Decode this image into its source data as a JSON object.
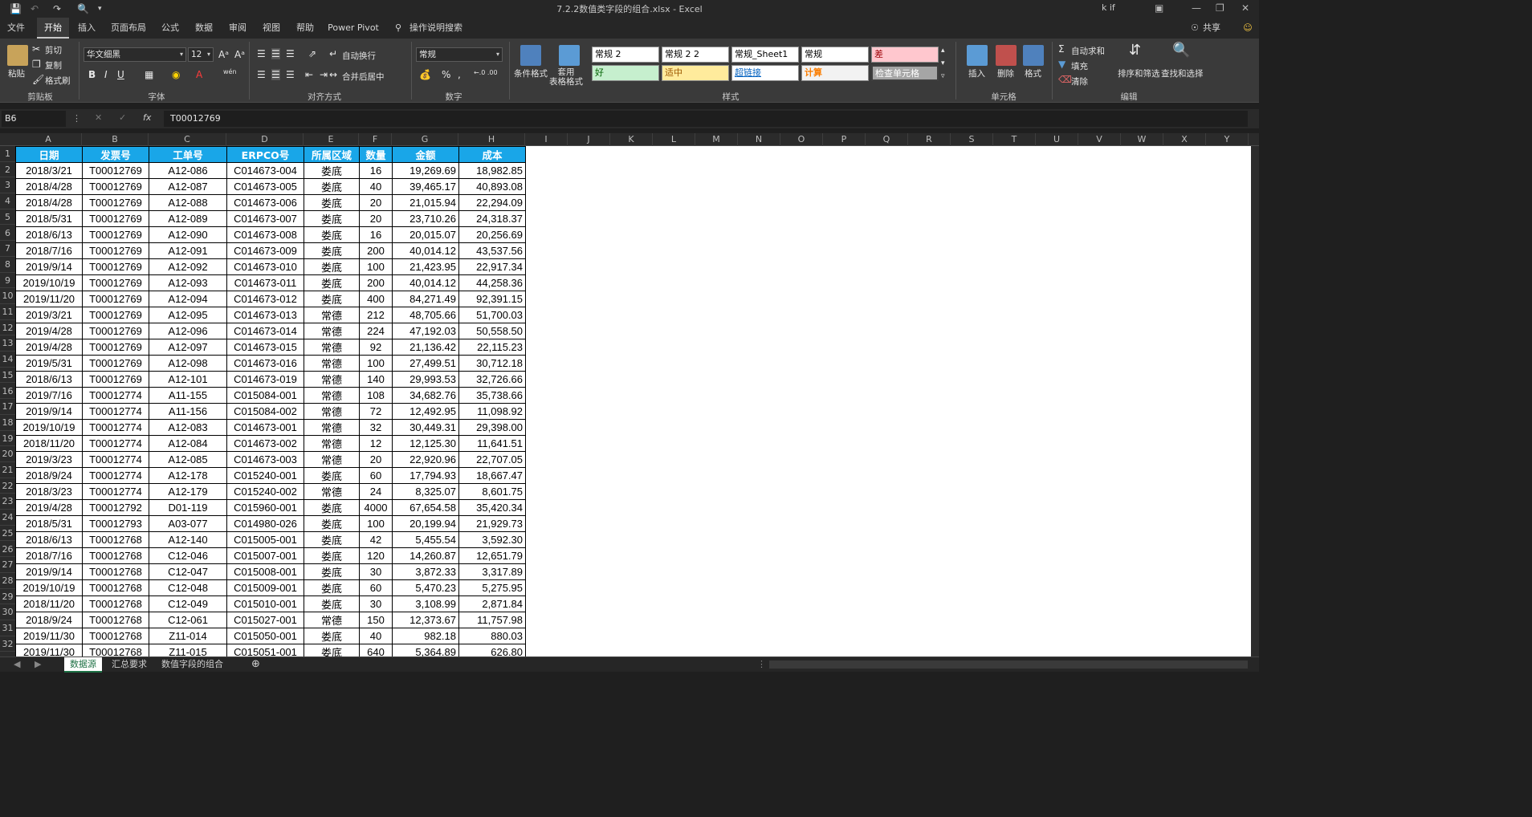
{
  "window": {
    "title": "7.2.2数值类字段的组合.xlsx  -  Excel",
    "user": "k if",
    "share_label": "共享"
  },
  "ribbon_tabs": [
    "文件",
    "开始",
    "插入",
    "页面布局",
    "公式",
    "数据",
    "审阅",
    "视图",
    "帮助",
    "Power Pivot",
    "操作说明搜索"
  ],
  "clipboard": {
    "paste": "粘贴",
    "cut": "剪切",
    "copy": "复制",
    "format_painter": "格式刷",
    "label": "剪贴板"
  },
  "font": {
    "name": "华文细黑",
    "size": "12",
    "label": "字体",
    "bold": "B",
    "italic": "I",
    "underline": "U",
    "phonetic": "wén"
  },
  "alignment": {
    "wrap": "自动换行",
    "merge": "合并后居中",
    "label": "对齐方式"
  },
  "number": {
    "format": "常规",
    "label": "数字",
    "percent": "%",
    "comma": ",",
    "inc_decimal": "←.0 .00",
    "dec_decimal": ".00 →.0"
  },
  "styles_group": {
    "conditional": "条件格式",
    "table": "套用\n表格格式",
    "cells": [
      {
        "text": "常规 2",
        "bg": "#ffffff",
        "fg": "#000000"
      },
      {
        "text": "常规 2 2",
        "bg": "#ffffff",
        "fg": "#000000"
      },
      {
        "text": "常规_Sheet1",
        "bg": "#ffffff",
        "fg": "#000000"
      },
      {
        "text": "常规",
        "bg": "#ffffff",
        "fg": "#000000"
      },
      {
        "text": "差",
        "bg": "#ffc7ce",
        "fg": "#9c0006"
      },
      {
        "text": "好",
        "bg": "#c6efce",
        "fg": "#006100"
      },
      {
        "text": "适中",
        "bg": "#ffeb9c",
        "fg": "#9c5700"
      },
      {
        "text": "超链接",
        "bg": "#ffffff",
        "fg": "#0563c1"
      },
      {
        "text": "计算",
        "bg": "#f2f2f2",
        "fg": "#fa7d00"
      },
      {
        "text": "检查单元格",
        "bg": "#a5a5a5",
        "fg": "#ffffff"
      }
    ],
    "label": "样式"
  },
  "cells_group": {
    "insert": "插入",
    "delete": "删除",
    "format": "格式",
    "label": "单元格"
  },
  "editing": {
    "autosum": "自动求和",
    "fill": "填充",
    "clear": "清除",
    "sort": "排序和筛选",
    "find": "查找和选择",
    "label": "编辑"
  },
  "formula_bar": {
    "name_box": "B6",
    "value": "T00012769",
    "fx": "fx"
  },
  "columns": [
    "A",
    "B",
    "C",
    "D",
    "E",
    "F",
    "G",
    "H",
    "I",
    "J",
    "K",
    "L",
    "M",
    "N",
    "O",
    "P",
    "Q",
    "R",
    "S",
    "T",
    "U",
    "V",
    "W",
    "X",
    "Y"
  ],
  "table": {
    "headers": [
      "日期",
      "发票号",
      "工单号",
      "ERPCO号",
      "所属区域",
      "数量",
      "金额",
      "成本"
    ],
    "rows": [
      [
        "2018/3/21",
        "T00012769",
        "A12-086",
        "C014673-004",
        "娄底",
        "16",
        "19,269.69",
        "18,982.85"
      ],
      [
        "2018/4/28",
        "T00012769",
        "A12-087",
        "C014673-005",
        "娄底",
        "40",
        "39,465.17",
        "40,893.08"
      ],
      [
        "2018/4/28",
        "T00012769",
        "A12-088",
        "C014673-006",
        "娄底",
        "20",
        "21,015.94",
        "22,294.09"
      ],
      [
        "2018/5/31",
        "T00012769",
        "A12-089",
        "C014673-007",
        "娄底",
        "20",
        "23,710.26",
        "24,318.37"
      ],
      [
        "2018/6/13",
        "T00012769",
        "A12-090",
        "C014673-008",
        "娄底",
        "16",
        "20,015.07",
        "20,256.69"
      ],
      [
        "2018/7/16",
        "T00012769",
        "A12-091",
        "C014673-009",
        "娄底",
        "200",
        "40,014.12",
        "43,537.56"
      ],
      [
        "2019/9/14",
        "T00012769",
        "A12-092",
        "C014673-010",
        "娄底",
        "100",
        "21,423.95",
        "22,917.34"
      ],
      [
        "2019/10/19",
        "T00012769",
        "A12-093",
        "C014673-011",
        "娄底",
        "200",
        "40,014.12",
        "44,258.36"
      ],
      [
        "2019/11/20",
        "T00012769",
        "A12-094",
        "C014673-012",
        "娄底",
        "400",
        "84,271.49",
        "92,391.15"
      ],
      [
        "2019/3/21",
        "T00012769",
        "A12-095",
        "C014673-013",
        "常德",
        "212",
        "48,705.66",
        "51,700.03"
      ],
      [
        "2019/4/28",
        "T00012769",
        "A12-096",
        "C014673-014",
        "常德",
        "224",
        "47,192.03",
        "50,558.50"
      ],
      [
        "2019/4/28",
        "T00012769",
        "A12-097",
        "C014673-015",
        "常德",
        "92",
        "21,136.42",
        "22,115.23"
      ],
      [
        "2019/5/31",
        "T00012769",
        "A12-098",
        "C014673-016",
        "常德",
        "100",
        "27,499.51",
        "30,712.18"
      ],
      [
        "2018/6/13",
        "T00012769",
        "A12-101",
        "C014673-019",
        "常德",
        "140",
        "29,993.53",
        "32,726.66"
      ],
      [
        "2019/7/16",
        "T00012774",
        "A11-155",
        "C015084-001",
        "常德",
        "108",
        "34,682.76",
        "35,738.66"
      ],
      [
        "2019/9/14",
        "T00012774",
        "A11-156",
        "C015084-002",
        "常德",
        "72",
        "12,492.95",
        "11,098.92"
      ],
      [
        "2019/10/19",
        "T00012774",
        "A12-083",
        "C014673-001",
        "常德",
        "32",
        "30,449.31",
        "29,398.00"
      ],
      [
        "2018/11/20",
        "T00012774",
        "A12-084",
        "C014673-002",
        "常德",
        "12",
        "12,125.30",
        "11,641.51"
      ],
      [
        "2019/3/23",
        "T00012774",
        "A12-085",
        "C014673-003",
        "常德",
        "20",
        "22,920.96",
        "22,707.05"
      ],
      [
        "2018/9/24",
        "T00012774",
        "A12-178",
        "C015240-001",
        "娄底",
        "60",
        "17,794.93",
        "18,667.47"
      ],
      [
        "2018/3/23",
        "T00012774",
        "A12-179",
        "C015240-002",
        "常德",
        "24",
        "8,325.07",
        "8,601.75"
      ],
      [
        "2019/4/28",
        "T00012792",
        "D01-119",
        "C015960-001",
        "娄底",
        "4000",
        "67,654.58",
        "35,420.34"
      ],
      [
        "2018/5/31",
        "T00012793",
        "A03-077",
        "C014980-026",
        "娄底",
        "100",
        "20,199.94",
        "21,929.73"
      ],
      [
        "2018/6/13",
        "T00012768",
        "A12-140",
        "C015005-001",
        "娄底",
        "42",
        "5,455.54",
        "3,592.30"
      ],
      [
        "2018/7/16",
        "T00012768",
        "C12-046",
        "C015007-001",
        "娄底",
        "120",
        "14,260.87",
        "12,651.79"
      ],
      [
        "2019/9/14",
        "T00012768",
        "C12-047",
        "C015008-001",
        "娄底",
        "30",
        "3,872.33",
        "3,317.89"
      ],
      [
        "2019/10/19",
        "T00012768",
        "C12-048",
        "C015009-001",
        "娄底",
        "60",
        "5,470.23",
        "5,275.95"
      ],
      [
        "2018/11/20",
        "T00012768",
        "C12-049",
        "C015010-001",
        "娄底",
        "30",
        "3,108.99",
        "2,871.84"
      ],
      [
        "2018/9/24",
        "T00012768",
        "C12-061",
        "C015027-001",
        "常德",
        "150",
        "12,373.67",
        "11,757.98"
      ],
      [
        "2019/11/30",
        "T00012768",
        "Z11-014",
        "C015050-001",
        "娄底",
        "40",
        "982.18",
        "880.03"
      ],
      [
        "2019/11/30",
        "T00012768",
        "Z11-015",
        "C015051-001",
        "娄底",
        "640",
        "5,364.89",
        "626.80"
      ]
    ]
  },
  "sheet_tabs": [
    "数据源",
    "汇总要求",
    "数值字段的组合"
  ],
  "active_sheet": "数据源"
}
